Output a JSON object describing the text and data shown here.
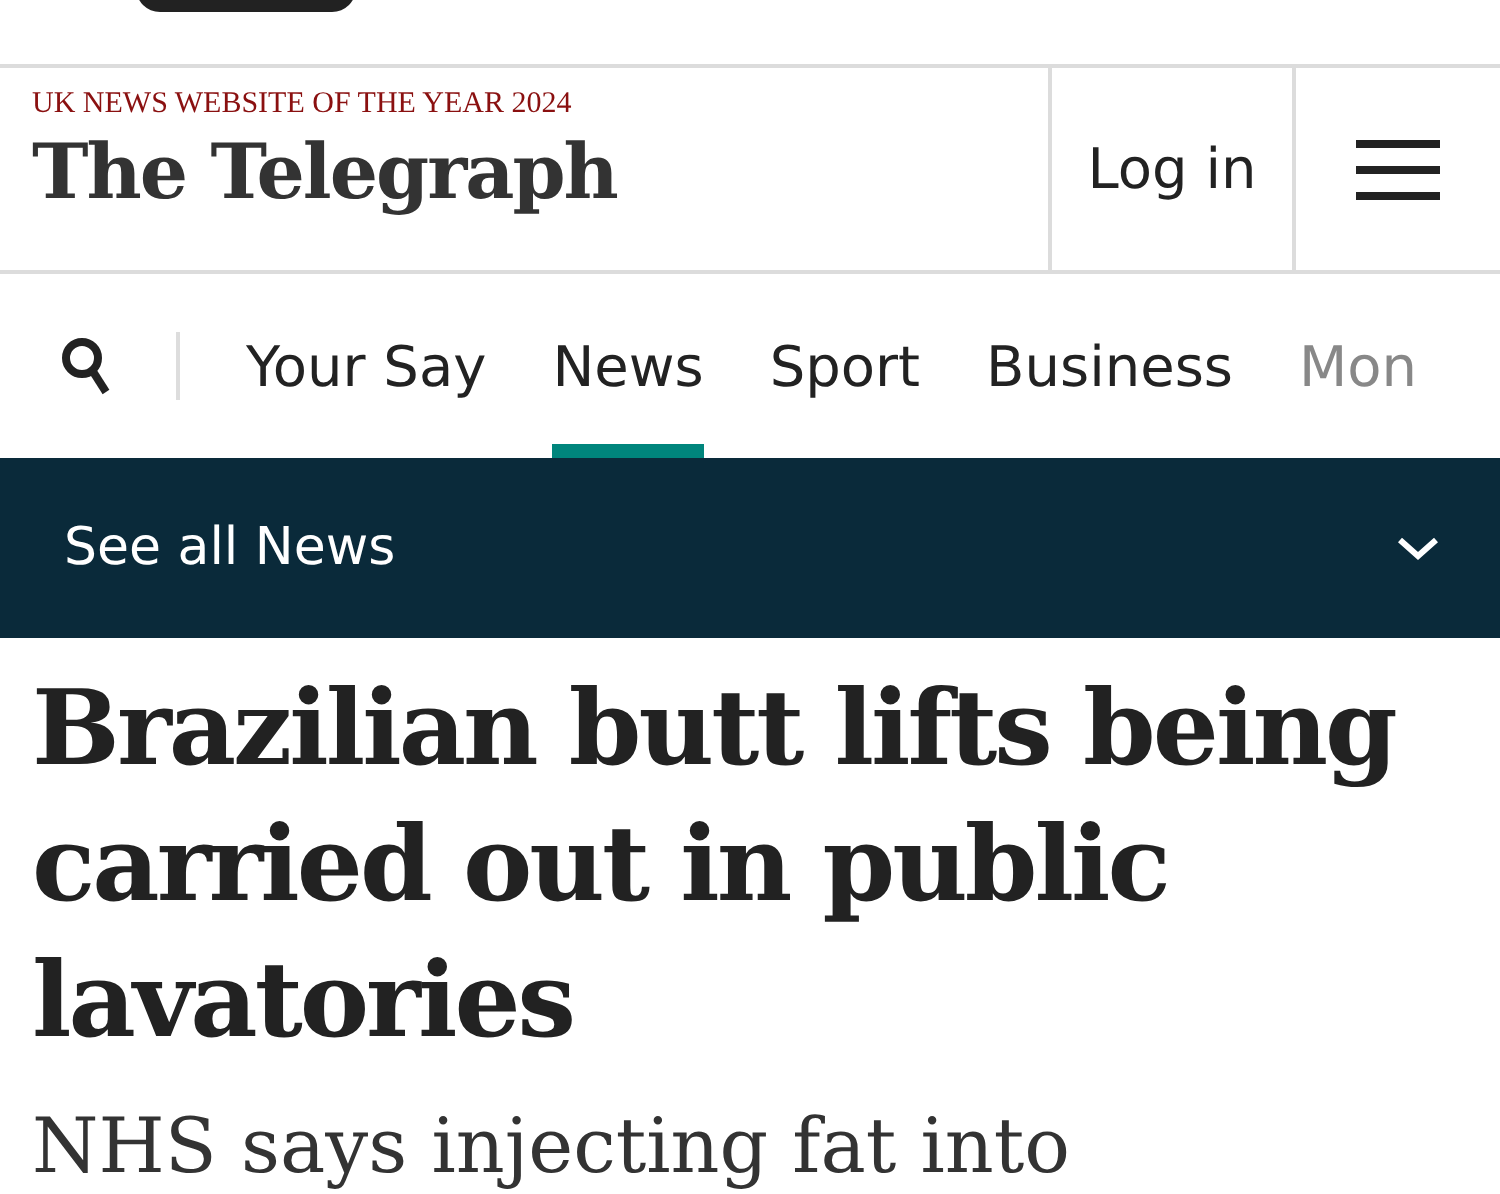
{
  "header": {
    "award": "UK NEWS WEBSITE OF THE YEAR 2024",
    "masthead": "The Telegraph",
    "login": "Log in"
  },
  "nav": {
    "tabs": [
      {
        "label": "Your Say",
        "selected": false
      },
      {
        "label": "News",
        "selected": true
      },
      {
        "label": "Sport",
        "selected": false
      },
      {
        "label": "Business",
        "selected": false
      },
      {
        "label": "Mon",
        "selected": false
      }
    ]
  },
  "section_bar": {
    "label": "See all News"
  },
  "article": {
    "headline": "Brazilian butt lifts being carried out in public lavatories",
    "standfirst": "NHS says injecting fat into"
  }
}
